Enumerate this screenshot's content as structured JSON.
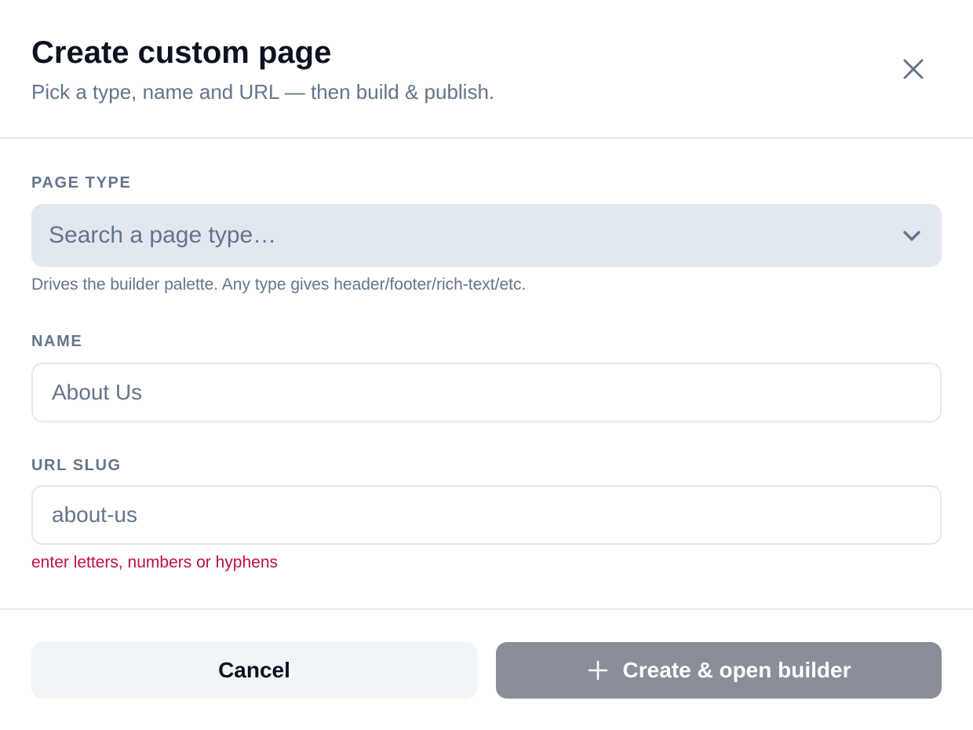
{
  "header": {
    "title": "Create custom page",
    "subtitle": "Pick a type, name and URL — then build & publish.",
    "close_icon": "close-icon"
  },
  "form": {
    "page_type": {
      "label": "PAGE TYPE",
      "placeholder": "Search a page type…",
      "hint": "Drives the builder palette. Any type gives header/footer/rich-text/etc.",
      "icon": "chevron-down-icon"
    },
    "name": {
      "label": "NAME",
      "value": "",
      "placeholder": "About Us"
    },
    "url_slug": {
      "label": "URL SLUG",
      "value": "",
      "placeholder": "about-us",
      "error": "enter letters, numbers or hyphens"
    }
  },
  "footer": {
    "cancel_label": "Cancel",
    "create_label": "Create & open builder",
    "create_icon": "plus-icon"
  },
  "colors": {
    "title": "#0b1220",
    "muted": "#64748b",
    "border": "#e2e8f0",
    "select_bg": "#e2e8f0",
    "cancel_bg": "#f1f5f9",
    "create_bg_disabled": "#898e98",
    "error": "#be123c"
  }
}
